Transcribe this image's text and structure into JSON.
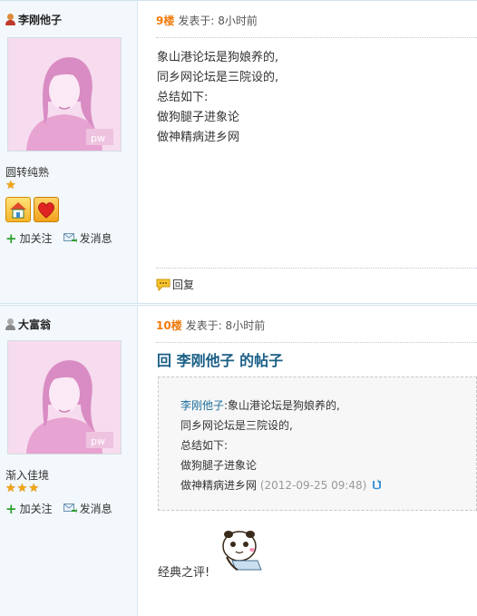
{
  "posts": [
    {
      "username": "李刚他子",
      "rank": "圆转纯熟",
      "stars": 1,
      "follow_label": "加关注",
      "message_label": "发消息",
      "floor": "9楼",
      "posted_at": "发表于: 8小时前",
      "content_lines": [
        "象山港论坛是狗娘养的,",
        "同乡网论坛是三院设的,",
        "总结如下:",
        "做狗腿子进象论",
        "做神精病进乡网"
      ],
      "reply_label": "回复"
    },
    {
      "username": "大富翁",
      "rank": "渐入佳境",
      "stars": 3,
      "follow_label": "加关注",
      "message_label": "发消息",
      "floor": "10楼",
      "posted_at": "发表于: 8小时前",
      "reply_title": "回 李刚他子 的帖子",
      "quote": {
        "author": "李刚他子",
        "first_line": ":象山港论坛是狗娘养的,",
        "lines": [
          "同乡网论坛是三院设的,",
          "总结如下:",
          "做狗腿子进象论"
        ],
        "last_line": "做神精病进乡网",
        "time": "(2012-09-25 09:48)"
      },
      "content": "经典之评!"
    }
  ],
  "colors": {
    "floor": "#f07b0c",
    "link": "#1a5f86",
    "sidebar_bg": "#f3f8fc"
  },
  "avatar_mark": "pw"
}
